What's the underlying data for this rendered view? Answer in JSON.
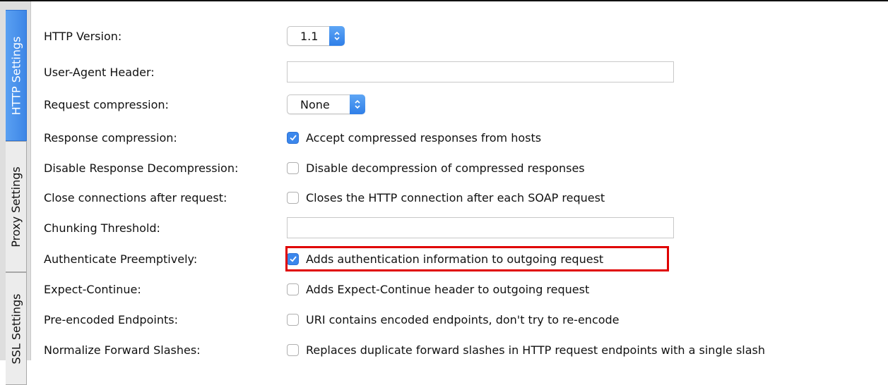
{
  "tabs": [
    {
      "label": "HTTP Settings",
      "active": true
    },
    {
      "label": "Proxy Settings",
      "active": false
    },
    {
      "label": "SSL Settings",
      "active": false
    }
  ],
  "settings": [
    {
      "label": "HTTP Version:",
      "type": "select",
      "value": "1.1"
    },
    {
      "label": "User-Agent Header:",
      "type": "text",
      "value": ""
    },
    {
      "label": "Request compression:",
      "type": "select",
      "value": "None"
    },
    {
      "label": "Response compression:",
      "type": "checkbox",
      "checked": true,
      "text": "Accept compressed responses from hosts"
    },
    {
      "label": "Disable Response Decompression:",
      "type": "checkbox",
      "checked": false,
      "text": "Disable decompression of compressed responses"
    },
    {
      "label": "Close connections after request:",
      "type": "checkbox",
      "checked": false,
      "text": "Closes the HTTP connection after each SOAP request"
    },
    {
      "label": "Chunking Threshold:",
      "type": "text",
      "value": ""
    },
    {
      "label": "Authenticate Preemptively:",
      "type": "checkbox",
      "checked": true,
      "text": "Adds authentication information to outgoing request"
    },
    {
      "label": "Expect-Continue:",
      "type": "checkbox",
      "checked": false,
      "text": "Adds Expect-Continue header to outgoing request"
    },
    {
      "label": "Pre-encoded Endpoints:",
      "type": "checkbox",
      "checked": false,
      "text": "URI contains encoded endpoints, don't try to re-encode"
    },
    {
      "label": "Normalize Forward Slashes:",
      "type": "checkbox",
      "checked": false,
      "text": "Replaces duplicate forward slashes in HTTP request endpoints with a single slash"
    }
  ],
  "colors": {
    "accent": "#3b87ec",
    "highlight": "#e00000"
  }
}
